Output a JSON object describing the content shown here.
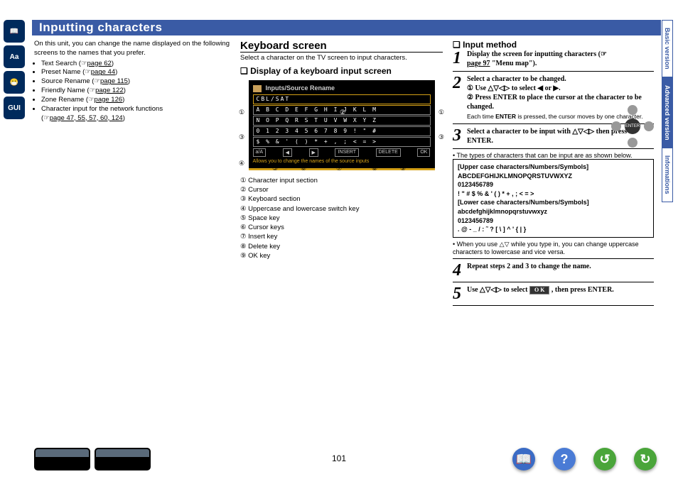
{
  "header": "Inputting characters",
  "intro": "On this unit, you can change the name displayed on the following screens to the names that you prefer.",
  "bullets": [
    {
      "label": "Text Search",
      "link": "page 62"
    },
    {
      "label": "Preset Name",
      "link": "page 44"
    },
    {
      "label": "Source Rename",
      "link": "page 115"
    },
    {
      "label": "Friendly Name",
      "link": "page 122"
    },
    {
      "label": "Zone Rename",
      "link": "page 126"
    },
    {
      "label": "Character input for the network functions",
      "link": "page 47, 55, 57, 60, 124"
    }
  ],
  "col2": {
    "h2": "Keyboard screen",
    "sub": "Select a character on the TV screen to input characters.",
    "h3": "❏ Display of a keyboard input screen",
    "kb_title": "Inputs/Source Rename",
    "kb_rows": [
      "CBL/SAT",
      "A B C D E F G H I J K L M",
      "N O P Q R S T U V W X Y Z",
      "0 1 2 3 4 5 6 7 8 9 ! \" #",
      "$ % & ' ( ) * + , ; < = >"
    ],
    "kb_foot": [
      "a/A",
      "◀",
      "▶",
      "INSERT",
      "DELETE",
      "OK"
    ],
    "kb_note": "Allows you to change the names of the source inputs",
    "legend": [
      "① Character input section",
      "② Cursor",
      "③ Keyboard section",
      "④ Uppercase and lowercase switch key",
      "⑤ Space key",
      "⑥ Cursor keys",
      "⑦ Insert key",
      "⑧ Delete key",
      "⑨ OK key"
    ]
  },
  "col3": {
    "h3": "❏ Input method",
    "steps": [
      {
        "n": "1",
        "t": "Display the screen for inputting characters (☞<u>page 97</u> \"Menu map\")."
      },
      {
        "n": "2",
        "t": "Select a character to be changed.",
        "sub": "① Use △▽◁▷ to select ◀ or ▶.<br>② Press <b>ENTER</b> to place the cursor at the character to be changed.",
        "note": "Each time <b>ENTER</b> is pressed, the cursor moves by one character."
      },
      {
        "n": "3",
        "t": "Select a character to be input with △▽◁▷ then press ENTER."
      },
      {
        "n": "4",
        "t": "Repeat steps 2 and 3 to change the name."
      },
      {
        "n": "5",
        "t": "Use △▽◁▷ to select <span class='okbtn'>O K</span> , then press ENTER."
      }
    ],
    "types_intro": "• The types of characters that can be input are as shown below.",
    "charbox": [
      "[Upper case characters/Numbers/Symbols]",
      "ABCDEFGHIJKLMNOPQRSTUVWXYZ",
      "0123456789",
      "! \" # $ % & ' ( ) * + , ; < = >",
      "[Lower case characters/Numbers/Symbols]",
      "abcdefghijklmnopqrstuvwxyz",
      "0123456789",
      ". @ - _ / : ˜ ? [ \\ ] ^ ' { | }"
    ],
    "case_note": "• When you use △▽ while you type in, you can change uppercase characters to lowercase and vice versa."
  },
  "tabs": [
    "Basic version",
    "Advanced version",
    "Informations"
  ],
  "page": "101",
  "leftIcons": [
    "📖",
    "Aa",
    "😷",
    "GUI"
  ]
}
